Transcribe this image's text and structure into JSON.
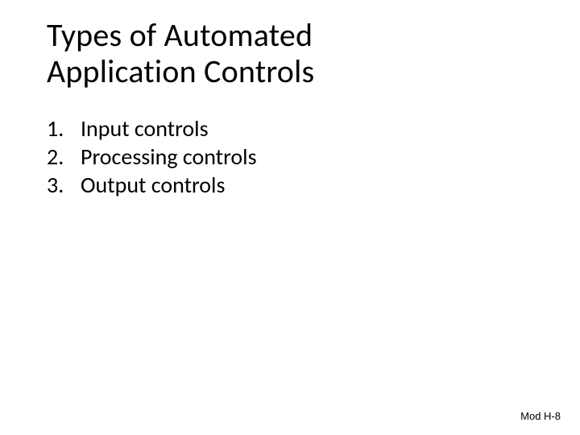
{
  "title_line1": "Types of Automated",
  "title_line2": "Application Controls",
  "items": [
    {
      "n": "1.",
      "label": "Input controls"
    },
    {
      "n": "2.",
      "label": "Processing controls"
    },
    {
      "n": "3.",
      "label": "Output controls"
    }
  ],
  "footer": "Mod H-8"
}
